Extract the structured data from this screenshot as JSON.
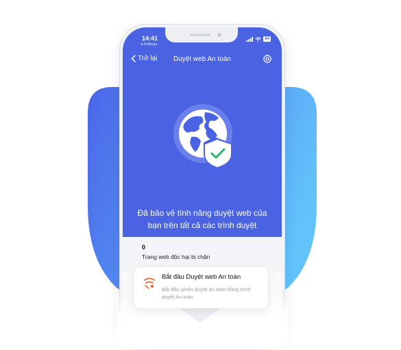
{
  "colors": {
    "primary_blue": "#4a63e3",
    "shield_light": "#62c3fb",
    "shield_dark": "#4a67e9",
    "check_green": "#26b565",
    "accent_orange": "#e8692c"
  },
  "status_bar": {
    "time": "14:41",
    "back_app": "◂ Settings",
    "signal_icon": "signal-icon",
    "wifi_icon": "wifi-icon",
    "battery": "64"
  },
  "navbar": {
    "back_label": "Trở lại",
    "title": "Duyệt web An toàn",
    "settings_icon": "gear-icon"
  },
  "hero": {
    "icon": "globe-shield-icon",
    "description": "Đã bảo vệ tính năng duyệt web của bạn trên tất cả các trình duyệt"
  },
  "stats": {
    "blocked_count": "0",
    "blocked_label": "Trang web độc hại bị chặn"
  },
  "action_card": {
    "icon": "safe-browsing-icon",
    "title": "Bắt đầu Duyệt web An toàn",
    "subtitle": "Bắt đầu phiên duyệt an toàn bằng trình duyệt An toàn"
  }
}
